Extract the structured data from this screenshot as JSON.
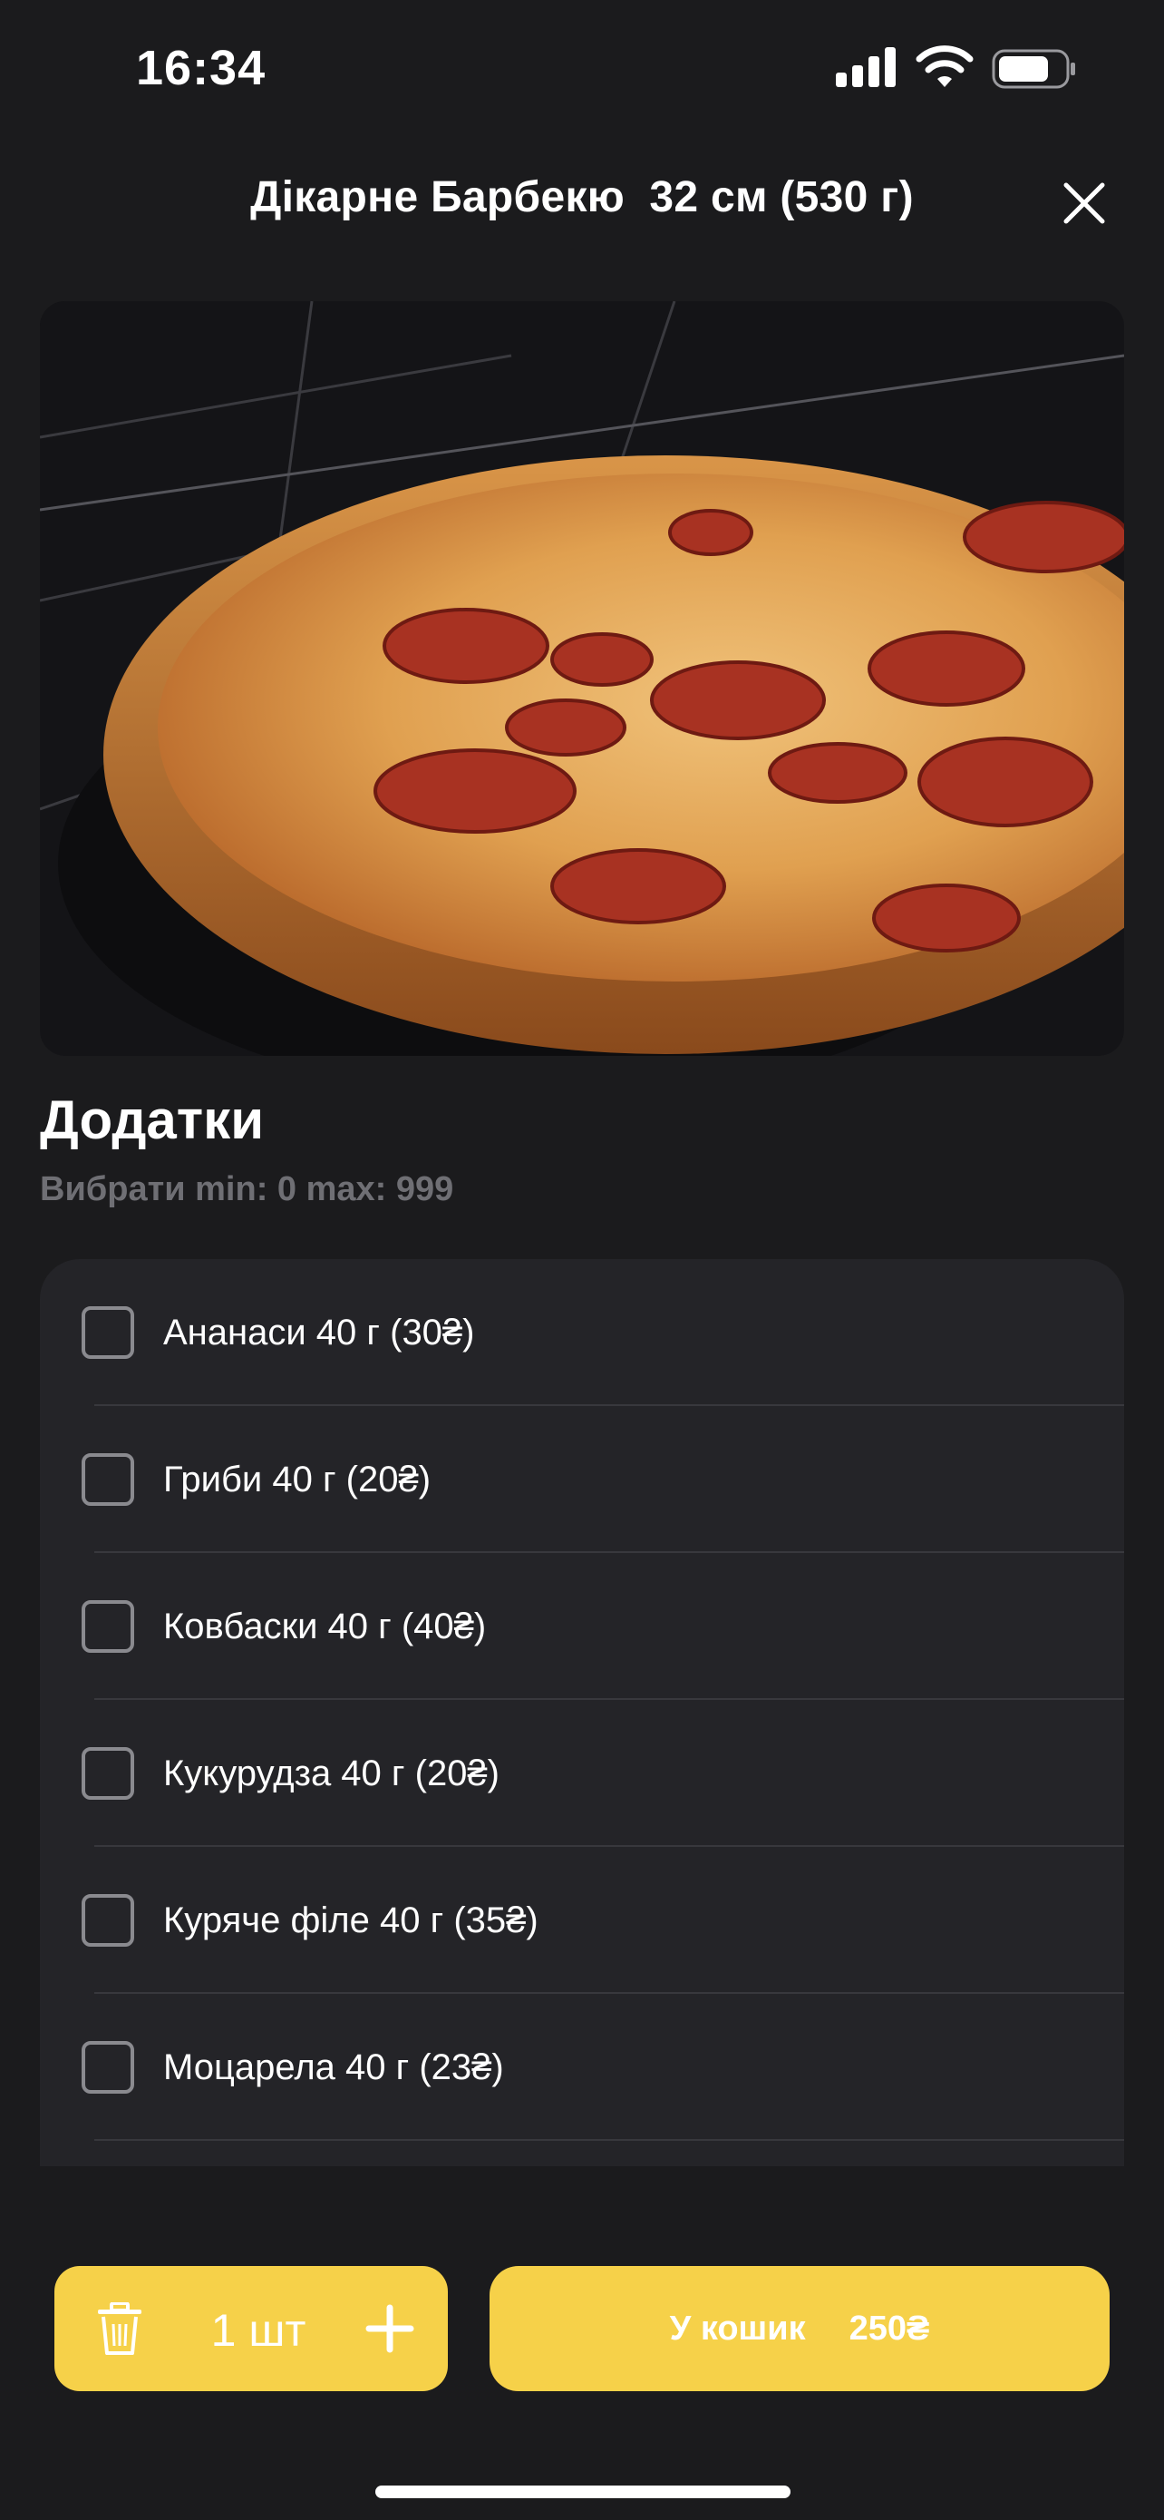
{
  "status_bar": {
    "time": "16:34",
    "icons": [
      "signal-icon",
      "wifi-icon",
      "battery-icon"
    ]
  },
  "header": {
    "title": "Дікарне Барбекю  32 см (530 г)",
    "close_icon": "close-icon"
  },
  "product_image": "pizza-photo",
  "addons": {
    "title": "Додатки",
    "subtitle": "Вибрати min: 0 max: 999",
    "items": [
      {
        "label": "Ананаси 40 г (30₴)",
        "checked": false
      },
      {
        "label": "Гриби 40 г (20₴)",
        "checked": false
      },
      {
        "label": "Ковбаски 40 г (40₴)",
        "checked": false
      },
      {
        "label": "Кукурудза 40 г (20₴)",
        "checked": false
      },
      {
        "label": "Куряче філе 40 г (35₴)",
        "checked": false
      },
      {
        "label": "Моцарела 40 г (23₴)",
        "checked": false
      }
    ]
  },
  "quantity": {
    "value": "1 шт",
    "trash_icon": "trash-icon",
    "plus_icon": "plus-icon"
  },
  "cart": {
    "label": "У кошик",
    "price": "250₴"
  },
  "colors": {
    "background": "#1b1b1d",
    "card": "#242428",
    "accent": "#f6d149",
    "muted_text": "#6f6f74"
  }
}
